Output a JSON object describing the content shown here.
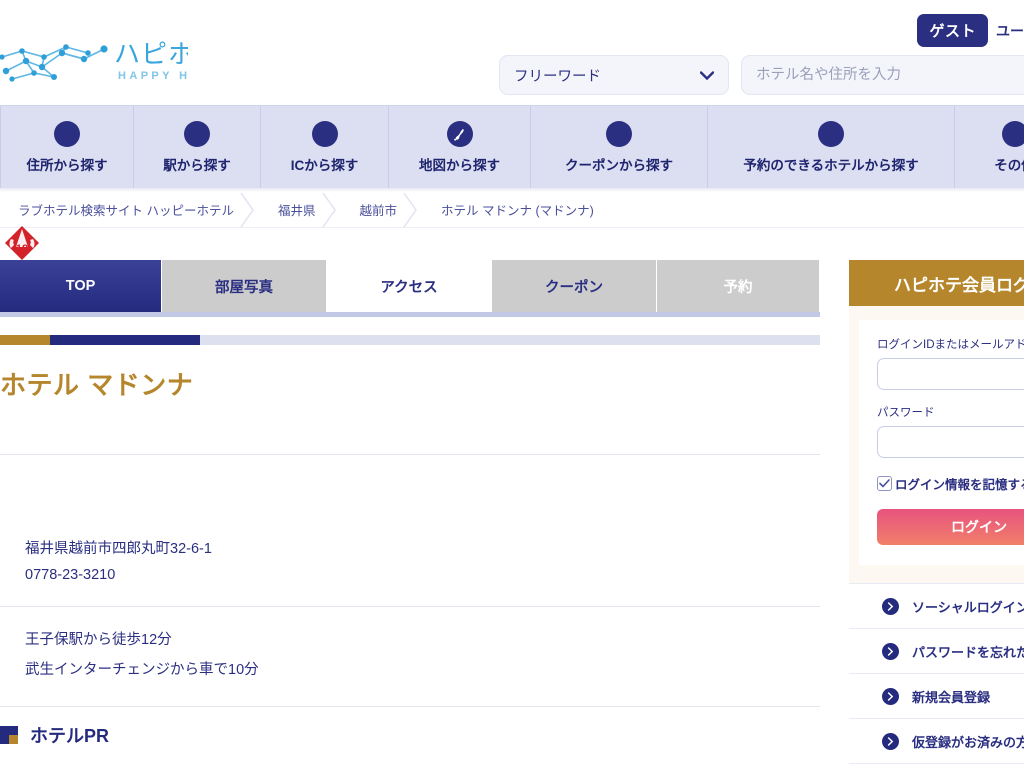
{
  "header": {
    "logo_text": "ハピホテ",
    "logo_subtext": "HAPPY HOTEL",
    "guest_badge": "ゲスト",
    "guest_user_label": "ユー",
    "search_select_value": "フリーワード",
    "search_input_value": "",
    "search_placeholder": "ホテル名や住所を入力"
  },
  "nav": {
    "items": [
      {
        "label": "住所から探す",
        "icon": "circle-icon"
      },
      {
        "label": "駅から探す",
        "icon": "circle-icon"
      },
      {
        "label": "ICから探す",
        "icon": "circle-icon"
      },
      {
        "label": "地図から探す",
        "icon": "japan-map-icon"
      },
      {
        "label": "クーポンから探す",
        "icon": "circle-icon"
      },
      {
        "label": "予約のできるホテルから探す",
        "icon": "circle-icon"
      },
      {
        "label": "その他",
        "icon": "circle-icon"
      }
    ]
  },
  "breadcrumb": {
    "items": [
      "ラブホテル検索サイト ハッピーホテル",
      "福井県",
      "越前市",
      "ホテル マドンナ (マドンナ)"
    ]
  },
  "main": {
    "tabs": [
      {
        "label": "TOP",
        "state": "active"
      },
      {
        "label": "部屋写真",
        "state": "plain"
      },
      {
        "label": "アクセス",
        "state": "current"
      },
      {
        "label": "クーポン",
        "state": "plain"
      },
      {
        "label": "予約",
        "state": "disabled"
      }
    ],
    "hotel_title": "ホテル マドンナ",
    "age_badge": "18",
    "address": "福井県越前市四郎丸町32-6-1",
    "phone": "0778-23-3210",
    "access": [
      "王子保駅から徒歩12分",
      "武生インターチェンジから車で10分"
    ],
    "pr_heading": "ホテルPR"
  },
  "sidebar": {
    "login_title": "ハピホテ会員ログイン",
    "id_label": "ログインIDまたはメールアドレス",
    "id_value": "",
    "password_label": "パスワード",
    "password_value": "",
    "remember_label": "ログイン情報を記憶する",
    "login_button": "ログイン",
    "links": [
      "ソーシャルログイン",
      "パスワードを忘れた方",
      "新規会員登録",
      "仮登録がお済みの方"
    ]
  },
  "colors": {
    "navy": "#242a7e",
    "gold": "#b5862b",
    "nav_bg": "#dcdff1",
    "tab_grey": "#cccccc",
    "login_pink": "#e8537f",
    "badge_red": "#d3222a"
  }
}
